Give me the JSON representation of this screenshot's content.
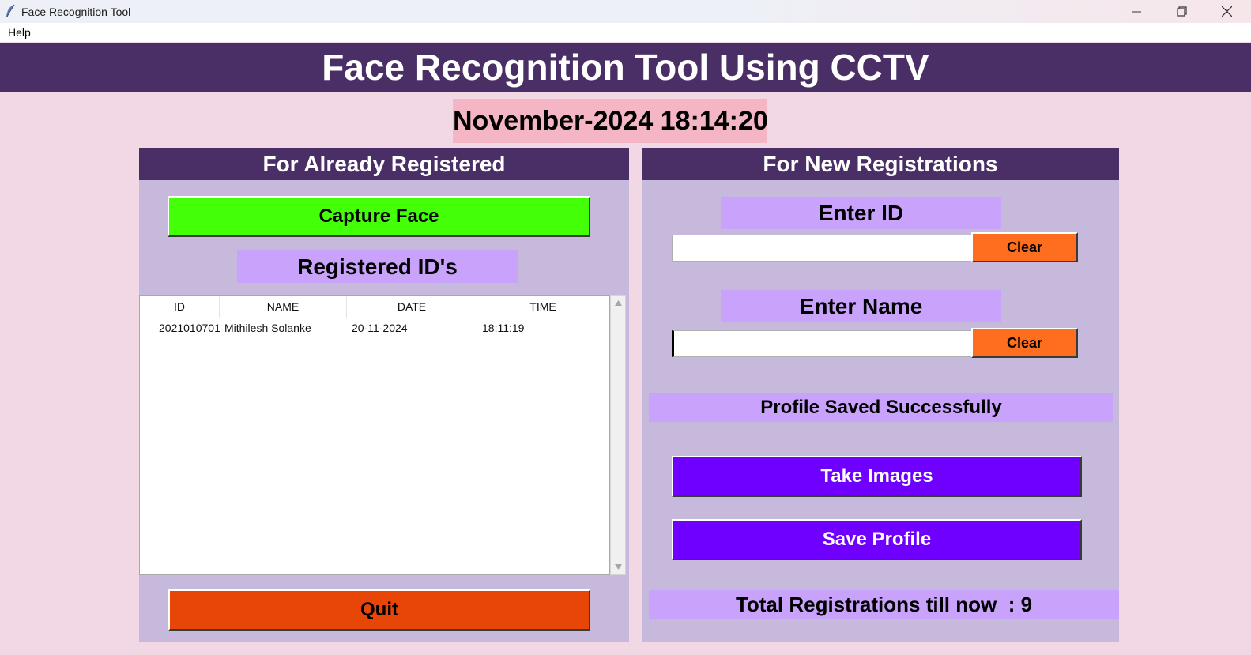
{
  "window": {
    "title": "Face Recognition Tool",
    "menu": [
      "Help"
    ]
  },
  "header": {
    "title": "Face Recognition Tool Using CCTV",
    "datetime": "November-2024 18:14:20"
  },
  "left_panel": {
    "heading": "For Already Registered",
    "capture_label": "Capture Face",
    "registered_label": "Registered ID's",
    "table": {
      "columns": [
        "ID",
        "NAME",
        "DATE",
        "TIME"
      ],
      "rows": [
        [
          "2021010701",
          "Mithilesh Solanke",
          "20-11-2024",
          "18:11:19"
        ]
      ]
    },
    "quit_label": "Quit"
  },
  "right_panel": {
    "heading": "For New Registrations",
    "enter_id_label": "Enter ID",
    "id_value": "",
    "clear_label": "Clear",
    "enter_name_label": "Enter Name",
    "name_value": "",
    "status_message": "Profile Saved Successfully",
    "take_images_label": "Take Images",
    "save_profile_label": "Save Profile",
    "total_label": "Total Registrations till now  : 9"
  },
  "colors": {
    "banner": "#4a2f66",
    "background": "#f2d7e4",
    "panel": "#c6b9dc",
    "tag": "#c9a2fb",
    "capture": "#43ff08",
    "quit": "#e84606",
    "clear": "#ff6d1f",
    "action": "#6f00ff",
    "datetime": "#f4b5c4"
  }
}
